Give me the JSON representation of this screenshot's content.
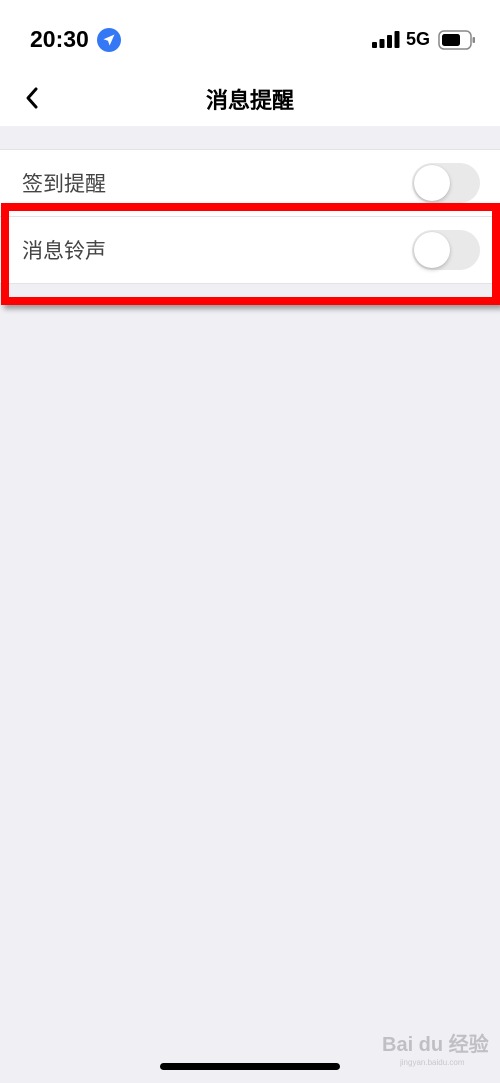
{
  "status_bar": {
    "time": "20:30",
    "network": "5G",
    "icons": [
      "location-arrow-icon",
      "signal-bars-icon",
      "battery-icon"
    ]
  },
  "nav": {
    "title": "消息提醒",
    "back_icon": "chevron-left-icon"
  },
  "settings": {
    "items": [
      {
        "label": "签到提醒",
        "enabled": false
      },
      {
        "label": "消息铃声",
        "enabled": false
      }
    ]
  },
  "highlight": {
    "target": "消息铃声",
    "color": "#ff0000"
  },
  "watermark": {
    "text": "Bai du 经验",
    "sub": "jingyan.baidu.com"
  },
  "colors": {
    "background": "#efeff4",
    "toggle_off": "#e9e9ea",
    "location_blue": "#3478f6"
  }
}
